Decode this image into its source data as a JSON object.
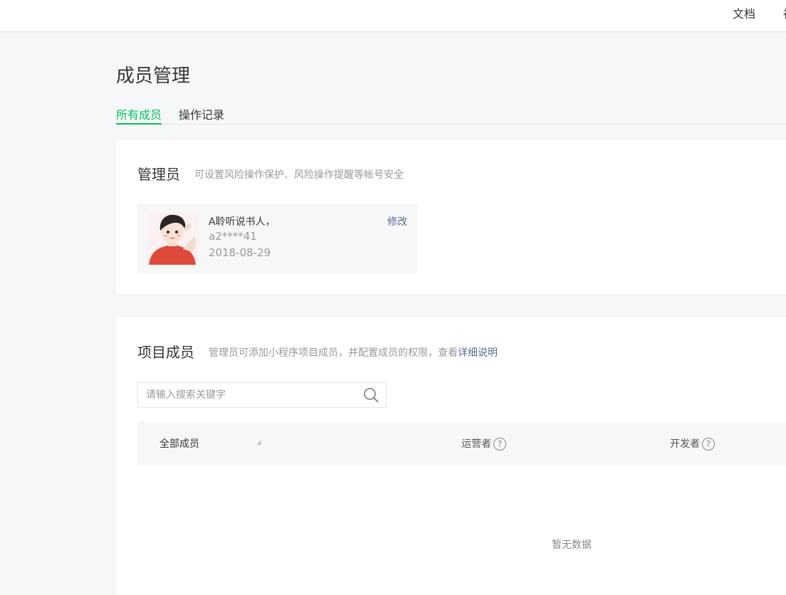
{
  "topbar": {
    "docs_label": "文档",
    "cut_label": "社"
  },
  "page": {
    "title": "成员管理"
  },
  "tabs": [
    {
      "label": "所有成员",
      "active": true
    },
    {
      "label": "操作记录",
      "active": false
    }
  ],
  "admin_section": {
    "title": "管理员",
    "desc": "可设置风险操作保护、风险操作提醒等帐号安全",
    "admin": {
      "name": "A聆听说书人，",
      "account": "a2****41",
      "date": "2018-08-29",
      "edit_label": "修改"
    }
  },
  "members_section": {
    "title": "项目成员",
    "desc": "管理员可添加小程序项目成员，并配置成员的权限，查看",
    "desc_link": "详细说明",
    "search_placeholder": "请输入搜索关键字",
    "columns": {
      "all": "全部成员",
      "operator": "运营者",
      "developer": "开发者"
    },
    "help_glyph": "?",
    "empty_text": "暂无数据"
  },
  "colors": {
    "accent": "#07c160",
    "link": "#576b95",
    "muted": "#9a9a9a"
  }
}
